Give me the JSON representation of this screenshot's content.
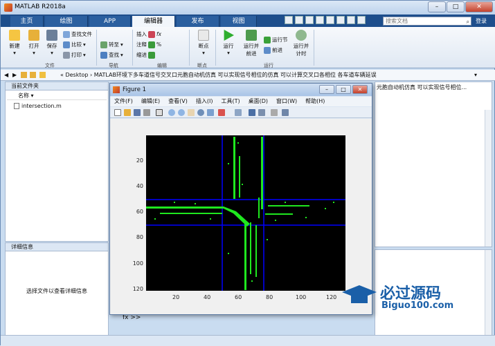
{
  "app": {
    "title": "MATLAB R2018a"
  },
  "tabs": [
    "主页",
    "绘图",
    "APP",
    "编辑器",
    "发布",
    "视图"
  ],
  "search": {
    "placeholder": "搜索文档",
    "help": "登录"
  },
  "ribbon": {
    "file": {
      "new": "新建",
      "open": "打开",
      "save": "保存",
      "find_files": "查找文件",
      "compare": "比较",
      "print": "打印",
      "group": "文件"
    },
    "navigate": {
      "goto": "转至",
      "find": "查找",
      "group": "导航"
    },
    "edit": {
      "insert": "插入",
      "comment": "注释",
      "indent": "缩进",
      "group": "编辑"
    },
    "breakpoints": {
      "label": "断点",
      "group": "断点"
    },
    "run": {
      "run": "运行",
      "run_advance": "运行并前进",
      "run_section": "运行节",
      "advance": "前进",
      "run_time": "运行并计时",
      "group": "运行"
    }
  },
  "address": {
    "path": "« Desktop › MATLAB环境下多车道信号交叉口元胞自动机仿真 可以实现信号相位的仿真 可以计算交叉口各相位 各车道车辆延误"
  },
  "left_panel": {
    "header": "当前文件夹",
    "column": "名称",
    "files": [
      "intersection.m"
    ],
    "detail_header": "详细信息",
    "detail_text": "选择文件以查看详细信息"
  },
  "right_panel": {
    "path_fragment": "元胞自动机仿真 可以实现信号相位..."
  },
  "figure": {
    "title": "Figure 1",
    "menu": [
      "文件(F)",
      "编辑(E)",
      "查看(V)",
      "插入(I)",
      "工具(T)",
      "桌面(D)",
      "窗口(W)",
      "帮助(H)"
    ],
    "yticks": [
      "20",
      "40",
      "60",
      "80",
      "100",
      "120"
    ],
    "xticks": [
      "20",
      "40",
      "60",
      "80",
      "100",
      "120"
    ]
  },
  "command": {
    "prompt": "fx >>"
  },
  "watermark": {
    "title": "必过源码",
    "url": "Biguo100.com"
  },
  "colors": {
    "tabbar": "#1e4e8c",
    "lane": "#0000ff",
    "vehicle": "#1fe81f"
  }
}
